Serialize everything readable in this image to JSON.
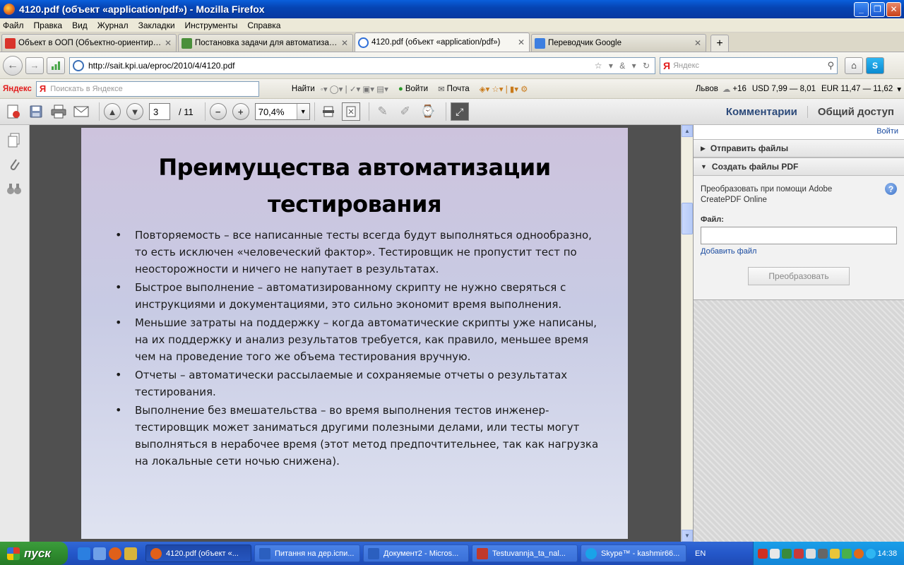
{
  "window": {
    "title": "4120.pdf (объект «application/pdf») - Mozilla Firefox"
  },
  "menu": [
    "Файл",
    "Правка",
    "Вид",
    "Журнал",
    "Закладки",
    "Инструменты",
    "Справка"
  ],
  "tabs": [
    {
      "label": "Объект в ООП (Объектно-ориентиров...",
      "color": "#d9342b"
    },
    {
      "label": "Постановка задачи для автоматизац...",
      "color": "#4a8f3a"
    },
    {
      "label": "4120.pdf (объект «application/pdf»)",
      "color": "#2f6fd8"
    },
    {
      "label": "Переводчик Google",
      "color": "#3d7fe0"
    }
  ],
  "nav": {
    "url": "http://sait.kpi.ua/eproc/2010/4/4120.pdf",
    "search_placeholder": "Яндекс",
    "search_logo": "Я"
  },
  "yandex_bar": {
    "brand": "Яндекс",
    "search_logo": "Я",
    "search_placeholder": "Поискать в Яндексе",
    "find": "Найти",
    "login": "Войти",
    "mail": "Почта",
    "city": "Львов",
    "temp": "+16",
    "usd": "USD 7,99 — 8,01",
    "eur": "EUR 11,47 — 11,62"
  },
  "pdf_toolbar": {
    "page_current": "3",
    "page_total": "/ 11",
    "zoom": "70,4%",
    "comments": "Комментарии",
    "share": "Общий доступ"
  },
  "slide": {
    "title_line1": "Преимущества автоматизации",
    "title_line2": "тестирования",
    "bullets": [
      "Повторяемость – все написанные тесты всегда будут выполняться однообразно, то есть исключен «человеческий фактор». Тестировщик не пропустит тест по неосторожности и ничего не напутает в результатах.",
      "Быстрое выполнение – автоматизированному скрипту не нужно сверяться с инструкциями и документациями, это сильно экономит время выполнения.",
      "Меньшие затраты на поддержку – когда автоматические скрипты уже написаны, на их поддержку и анализ результатов требуется, как правило, меньшее время чем на проведение того же объема тестирования вручную.",
      "Отчеты – автоматически рассылаемые и сохраняемые отчеты о результатах тестирования.",
      "Выполнение без вмешательства – во время выполнения тестов инженер-тестировщик может заниматься другими полезными делами, или тесты могут выполняться в нерабочее время (этот метод предпочтительнее, так как нагрузка на локальные сети ночью снижена)."
    ]
  },
  "right_panel": {
    "login": "Войти",
    "send_files": "Отправить файлы",
    "create_pdf": "Создать файлы PDF",
    "description": "Преобразовать при помощи Adobe CreatePDF Online",
    "file_label": "Файл:",
    "add_file": "Добавить файл",
    "convert": "Преобразовать"
  },
  "taskbar": {
    "start": "пуск",
    "tasks": [
      {
        "label": "4120.pdf (объект «...",
        "color": "#e0601a"
      },
      {
        "label": "Питання на дер.іспи...",
        "color": "#2b5fbf"
      },
      {
        "label": "Документ2 - Micros...",
        "color": "#2b5fbf"
      },
      {
        "label": "Testuvannja_ta_nal...",
        "color": "#c0392b"
      },
      {
        "label": "Skype™ - kashmir66...",
        "color": "#1aa3e8"
      }
    ],
    "lang": "EN",
    "clock": "14:38"
  }
}
